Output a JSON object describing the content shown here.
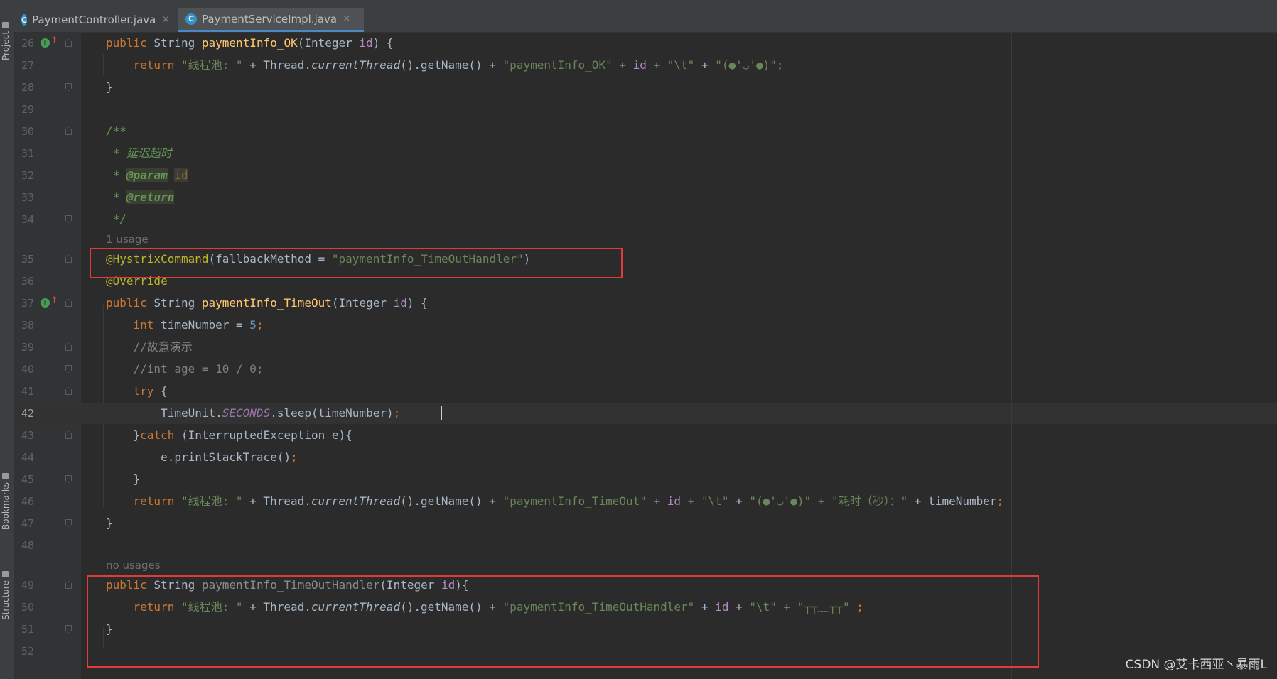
{
  "tabs": [
    {
      "label": "PaymentController.java",
      "icon": "class-c-icon",
      "active": false
    },
    {
      "label": "PaymentServiceImpl.java",
      "icon": "class-c-icon",
      "active": true
    }
  ],
  "side_panels": {
    "project": "Project",
    "bookmarks": "Bookmarks",
    "structure": "Structure"
  },
  "usage_hints": {
    "timeout": "1 usage",
    "handler": "no usages"
  },
  "lines": [
    {
      "n": "26",
      "text": "public String paymentInfo_OK(Integer id) {"
    },
    {
      "n": "27",
      "text": "    return \"线程池: \" + Thread.currentThread().getName() + \"paymentInfo_OK\" + id + \"\\t\" + \"(●'◡'●)\";"
    },
    {
      "n": "28",
      "text": "}"
    },
    {
      "n": "29",
      "text": ""
    },
    {
      "n": "30",
      "text": "/**"
    },
    {
      "n": "31",
      "text": " * 延迟超时"
    },
    {
      "n": "32",
      "text": " * @param id"
    },
    {
      "n": "33",
      "text": " * @return"
    },
    {
      "n": "34",
      "text": " */"
    },
    {
      "n": "35",
      "text": "@HystrixCommand(fallbackMethod = \"paymentInfo_TimeOutHandler\")"
    },
    {
      "n": "36",
      "text": "@Override"
    },
    {
      "n": "37",
      "text": "public String paymentInfo_TimeOut(Integer id) {"
    },
    {
      "n": "38",
      "text": "    int timeNumber = 5;"
    },
    {
      "n": "39",
      "text": "    //故意演示"
    },
    {
      "n": "40",
      "text": "    //int age = 10 / 0;"
    },
    {
      "n": "41",
      "text": "    try {"
    },
    {
      "n": "42",
      "text": "        TimeUnit.SECONDS.sleep(timeNumber);"
    },
    {
      "n": "43",
      "text": "    }catch (InterruptedException e){"
    },
    {
      "n": "44",
      "text": "        e.printStackTrace();"
    },
    {
      "n": "45",
      "text": "    }"
    },
    {
      "n": "46",
      "text": "    return \"线程池: \" + Thread.currentThread().getName() + \"paymentInfo_TimeOut\" + id + \"\\t\" + \"(●'◡'●)\" + \"耗时（秒）：\" + timeNumber;"
    },
    {
      "n": "47",
      "text": "}"
    },
    {
      "n": "48",
      "text": ""
    },
    {
      "n": "49",
      "text": "public String paymentInfo_TimeOutHandler(Integer id){"
    },
    {
      "n": "50",
      "text": "    return \"线程池: \" + Thread.currentThread().getName() + \"paymentInfo_TimeOutHandler\" + id + \"\\t\" + \"┬┬﹏┬┬\" ;"
    },
    {
      "n": "51",
      "text": "}"
    },
    {
      "n": "52",
      "text": ""
    }
  ],
  "current_line": "42",
  "watermark": "CSDN @艾卡西亚丶暴雨L",
  "colors": {
    "editor_bg": "#2b2b2b",
    "keyword": "#cc7832",
    "string": "#6a8759",
    "method": "#ffc66d",
    "annotation": "#bbb529",
    "highlight_box": "#e03a3a"
  }
}
